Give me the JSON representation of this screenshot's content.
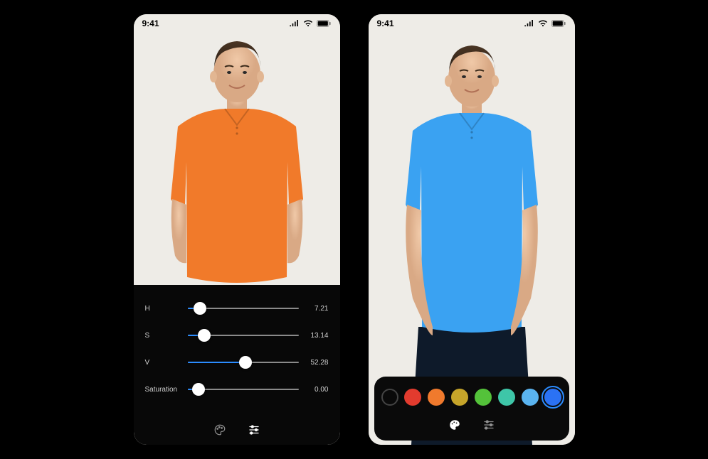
{
  "status": {
    "time": "9:41"
  },
  "left": {
    "shirt_color": "#f17a2a",
    "sliders": [
      {
        "label": "H",
        "value": "7.21",
        "percent": 11
      },
      {
        "label": "S",
        "value": "13.14",
        "percent": 15
      },
      {
        "label": "V",
        "value": "52.28",
        "percent": 52
      },
      {
        "label": "Saturation",
        "value": "0.00",
        "percent": 10
      }
    ],
    "active_tab": "sliders"
  },
  "right": {
    "shirt_color": "#3aa2f2",
    "swatches": [
      {
        "name": "black",
        "color": "#000000",
        "outlined": true,
        "selected": false
      },
      {
        "name": "red",
        "color": "#e23b2e",
        "outlined": false,
        "selected": false
      },
      {
        "name": "orange",
        "color": "#f07a2d",
        "outlined": false,
        "selected": false
      },
      {
        "name": "olive",
        "color": "#c6a52a",
        "outlined": false,
        "selected": false
      },
      {
        "name": "green",
        "color": "#54c23a",
        "outlined": false,
        "selected": false
      },
      {
        "name": "teal",
        "color": "#3ec6a8",
        "outlined": false,
        "selected": false
      },
      {
        "name": "sky",
        "color": "#5ab4f0",
        "outlined": false,
        "selected": false
      },
      {
        "name": "blue",
        "color": "#2b72f4",
        "outlined": false,
        "selected": true
      }
    ],
    "active_tab": "palette"
  }
}
